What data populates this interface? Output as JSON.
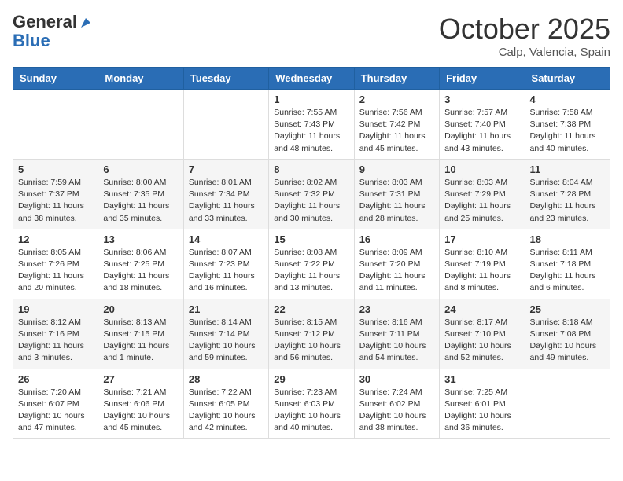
{
  "logo": {
    "general": "General",
    "blue": "Blue"
  },
  "title": "October 2025",
  "location": "Calp, Valencia, Spain",
  "weekdays": [
    "Sunday",
    "Monday",
    "Tuesday",
    "Wednesday",
    "Thursday",
    "Friday",
    "Saturday"
  ],
  "weeks": [
    [
      {
        "day": "",
        "info": ""
      },
      {
        "day": "",
        "info": ""
      },
      {
        "day": "",
        "info": ""
      },
      {
        "day": "1",
        "info": "Sunrise: 7:55 AM\nSunset: 7:43 PM\nDaylight: 11 hours\nand 48 minutes."
      },
      {
        "day": "2",
        "info": "Sunrise: 7:56 AM\nSunset: 7:42 PM\nDaylight: 11 hours\nand 45 minutes."
      },
      {
        "day": "3",
        "info": "Sunrise: 7:57 AM\nSunset: 7:40 PM\nDaylight: 11 hours\nand 43 minutes."
      },
      {
        "day": "4",
        "info": "Sunrise: 7:58 AM\nSunset: 7:38 PM\nDaylight: 11 hours\nand 40 minutes."
      }
    ],
    [
      {
        "day": "5",
        "info": "Sunrise: 7:59 AM\nSunset: 7:37 PM\nDaylight: 11 hours\nand 38 minutes."
      },
      {
        "day": "6",
        "info": "Sunrise: 8:00 AM\nSunset: 7:35 PM\nDaylight: 11 hours\nand 35 minutes."
      },
      {
        "day": "7",
        "info": "Sunrise: 8:01 AM\nSunset: 7:34 PM\nDaylight: 11 hours\nand 33 minutes."
      },
      {
        "day": "8",
        "info": "Sunrise: 8:02 AM\nSunset: 7:32 PM\nDaylight: 11 hours\nand 30 minutes."
      },
      {
        "day": "9",
        "info": "Sunrise: 8:03 AM\nSunset: 7:31 PM\nDaylight: 11 hours\nand 28 minutes."
      },
      {
        "day": "10",
        "info": "Sunrise: 8:03 AM\nSunset: 7:29 PM\nDaylight: 11 hours\nand 25 minutes."
      },
      {
        "day": "11",
        "info": "Sunrise: 8:04 AM\nSunset: 7:28 PM\nDaylight: 11 hours\nand 23 minutes."
      }
    ],
    [
      {
        "day": "12",
        "info": "Sunrise: 8:05 AM\nSunset: 7:26 PM\nDaylight: 11 hours\nand 20 minutes."
      },
      {
        "day": "13",
        "info": "Sunrise: 8:06 AM\nSunset: 7:25 PM\nDaylight: 11 hours\nand 18 minutes."
      },
      {
        "day": "14",
        "info": "Sunrise: 8:07 AM\nSunset: 7:23 PM\nDaylight: 11 hours\nand 16 minutes."
      },
      {
        "day": "15",
        "info": "Sunrise: 8:08 AM\nSunset: 7:22 PM\nDaylight: 11 hours\nand 13 minutes."
      },
      {
        "day": "16",
        "info": "Sunrise: 8:09 AM\nSunset: 7:20 PM\nDaylight: 11 hours\nand 11 minutes."
      },
      {
        "day": "17",
        "info": "Sunrise: 8:10 AM\nSunset: 7:19 PM\nDaylight: 11 hours\nand 8 minutes."
      },
      {
        "day": "18",
        "info": "Sunrise: 8:11 AM\nSunset: 7:18 PM\nDaylight: 11 hours\nand 6 minutes."
      }
    ],
    [
      {
        "day": "19",
        "info": "Sunrise: 8:12 AM\nSunset: 7:16 PM\nDaylight: 11 hours\nand 3 minutes."
      },
      {
        "day": "20",
        "info": "Sunrise: 8:13 AM\nSunset: 7:15 PM\nDaylight: 11 hours\nand 1 minute."
      },
      {
        "day": "21",
        "info": "Sunrise: 8:14 AM\nSunset: 7:14 PM\nDaylight: 10 hours\nand 59 minutes."
      },
      {
        "day": "22",
        "info": "Sunrise: 8:15 AM\nSunset: 7:12 PM\nDaylight: 10 hours\nand 56 minutes."
      },
      {
        "day": "23",
        "info": "Sunrise: 8:16 AM\nSunset: 7:11 PM\nDaylight: 10 hours\nand 54 minutes."
      },
      {
        "day": "24",
        "info": "Sunrise: 8:17 AM\nSunset: 7:10 PM\nDaylight: 10 hours\nand 52 minutes."
      },
      {
        "day": "25",
        "info": "Sunrise: 8:18 AM\nSunset: 7:08 PM\nDaylight: 10 hours\nand 49 minutes."
      }
    ],
    [
      {
        "day": "26",
        "info": "Sunrise: 7:20 AM\nSunset: 6:07 PM\nDaylight: 10 hours\nand 47 minutes."
      },
      {
        "day": "27",
        "info": "Sunrise: 7:21 AM\nSunset: 6:06 PM\nDaylight: 10 hours\nand 45 minutes."
      },
      {
        "day": "28",
        "info": "Sunrise: 7:22 AM\nSunset: 6:05 PM\nDaylight: 10 hours\nand 42 minutes."
      },
      {
        "day": "29",
        "info": "Sunrise: 7:23 AM\nSunset: 6:03 PM\nDaylight: 10 hours\nand 40 minutes."
      },
      {
        "day": "30",
        "info": "Sunrise: 7:24 AM\nSunset: 6:02 PM\nDaylight: 10 hours\nand 38 minutes."
      },
      {
        "day": "31",
        "info": "Sunrise: 7:25 AM\nSunset: 6:01 PM\nDaylight: 10 hours\nand 36 minutes."
      },
      {
        "day": "",
        "info": ""
      }
    ]
  ]
}
